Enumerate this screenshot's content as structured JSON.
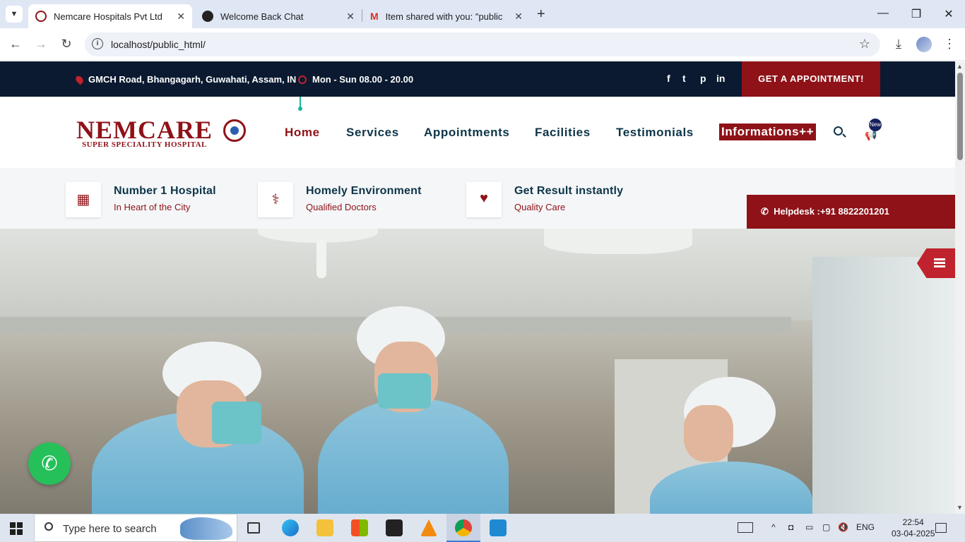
{
  "browser": {
    "tabs": [
      {
        "title": "Nemcare Hospitals Pvt Ltd",
        "active": true
      },
      {
        "title": "Welcome Back Chat",
        "active": false
      },
      {
        "title": "Item shared with you: \"public_h",
        "active": false
      }
    ],
    "url": "localhost/public_html/"
  },
  "site": {
    "topbar": {
      "address": "GMCH Road, Bhangagarh, Guwahati, Assam, IN",
      "hours": "Mon - Sun 08.00 - 20.00",
      "social": [
        "f",
        "t",
        "p",
        "in"
      ],
      "appointment_button": "GET A APPOINTMENT!"
    },
    "logo": {
      "name": "NEMCARE",
      "subtitle": "SUPER SPECIALITY HOSPITAL"
    },
    "nav": {
      "items": [
        "Home",
        "Services",
        "Appointments",
        "Facilities",
        "Testimonials",
        "Informations++"
      ],
      "active": "Home",
      "badge": "New"
    },
    "features": [
      {
        "title": "Number 1 Hospital",
        "subtitle": "In Heart of the City",
        "icon": "hospital-icon"
      },
      {
        "title": "Homely Environment",
        "subtitle": "Qualified Doctors",
        "icon": "doctor-icon"
      },
      {
        "title": "Get Result instantly",
        "subtitle": "Quality Care",
        "icon": "heartbeat-icon"
      }
    ],
    "helpdesk": "Helpdesk :+91 8822201201"
  },
  "taskbar": {
    "search_placeholder": "Type here to search",
    "language": "ENG",
    "time": "22:54",
    "date": "03-04-2025"
  },
  "colors": {
    "brand_red": "#8e1218",
    "navy": "#0b1a30",
    "text_dark": "#0d3548",
    "whatsapp_green": "#25c05a"
  }
}
